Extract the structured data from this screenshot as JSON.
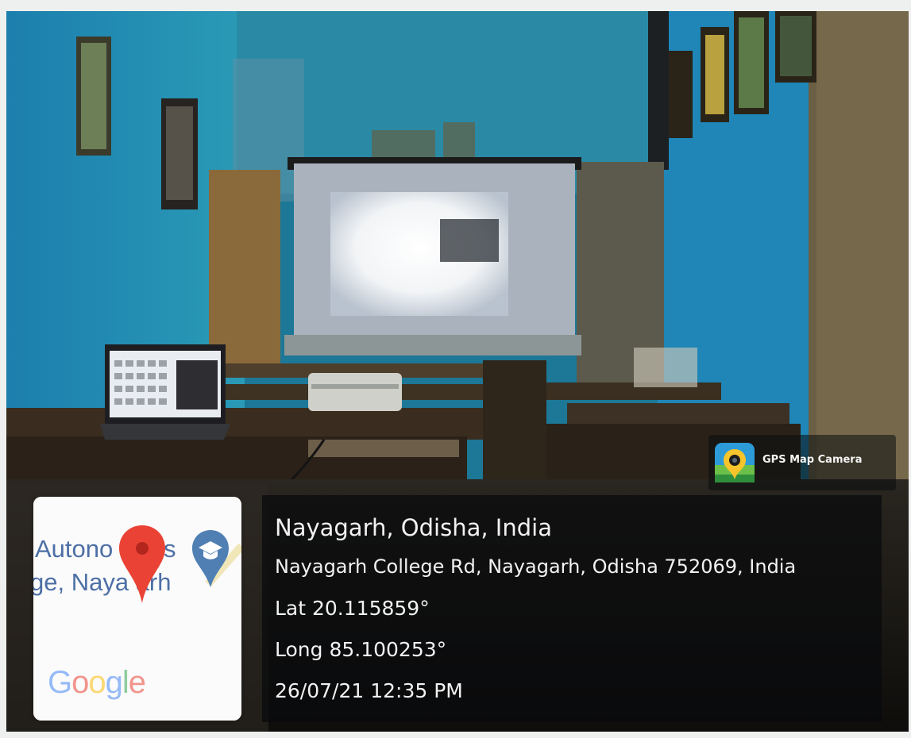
{
  "photo": {
    "description_free": true
  },
  "map_card": {
    "label_line1_a": "Autono",
    "label_line1_b": "s",
    "label_line2": "ge, Naya   arh",
    "pin_icon": "map-pin-icon",
    "edu_icon": "graduation-cap-marker-icon",
    "logo": {
      "letters": [
        "G",
        "o",
        "o",
        "g",
        "l",
        "e"
      ],
      "colors": [
        "#4285F4",
        "#EA4335",
        "#FBBC05",
        "#4285F4",
        "#34A853",
        "#EA4335"
      ]
    }
  },
  "info": {
    "title": "Nayagarh, Odisha, India",
    "address": "Nayagarh College Rd, Nayagarh, Odisha 752069, India",
    "lat": "Lat 20.115859°",
    "long": "Long 85.100253°",
    "datetime": "26/07/21 12:35 PM"
  },
  "badge": {
    "label": "GPS Map Camera",
    "icon": "gps-map-camera-app-icon"
  }
}
